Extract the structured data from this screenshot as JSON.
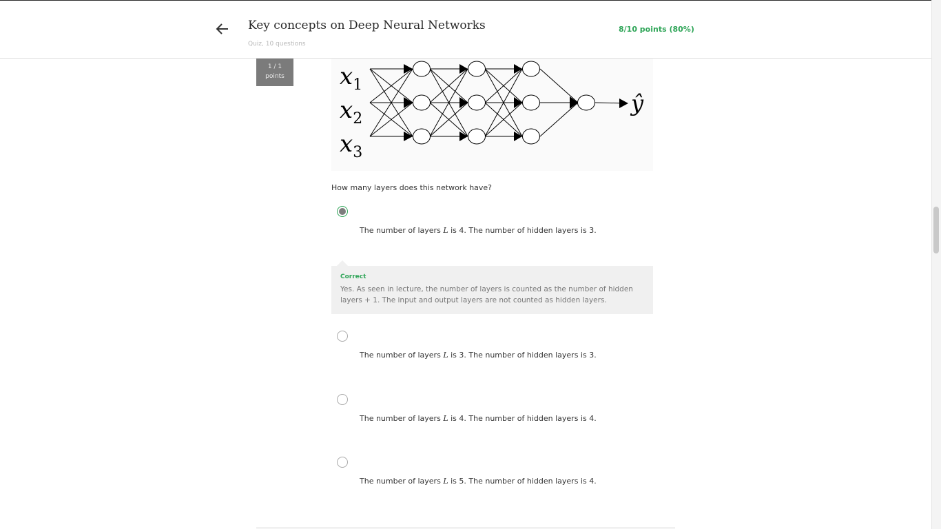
{
  "header": {
    "title": "Key concepts on Deep Neural Networks",
    "subtitle": "Quiz, 10 questions",
    "score": "8/10 points (80%)"
  },
  "question": {
    "points_value": "1 / 1",
    "points_label": "points",
    "prompt": "How many layers does this network have?",
    "figure": {
      "input_labels": [
        "x1",
        "x2",
        "x3"
      ],
      "output_label": "ŷ"
    },
    "options": [
      {
        "text_before": "The number of layers ",
        "var": "L",
        "text_after": " is 4. The number of hidden layers is 3.",
        "selected": true
      },
      {
        "text_before": "The number of layers ",
        "var": "L",
        "text_after": " is 3. The number of hidden layers is 3.",
        "selected": false
      },
      {
        "text_before": "The number of layers ",
        "var": "L",
        "text_after": " is 4. The number of hidden layers is 4.",
        "selected": false
      },
      {
        "text_before": "The number of layers ",
        "var": "L",
        "text_after": " is 5. The number of hidden layers is 4.",
        "selected": false
      }
    ],
    "feedback": {
      "label": "Correct",
      "text": "Yes. As seen in lecture, the number of layers is counted as the number of hidden layers + 1. The input and output layers are not counted as hidden layers."
    }
  },
  "colors": {
    "accent_green": "#2fa558",
    "badge_gray": "#7b7b7b"
  }
}
